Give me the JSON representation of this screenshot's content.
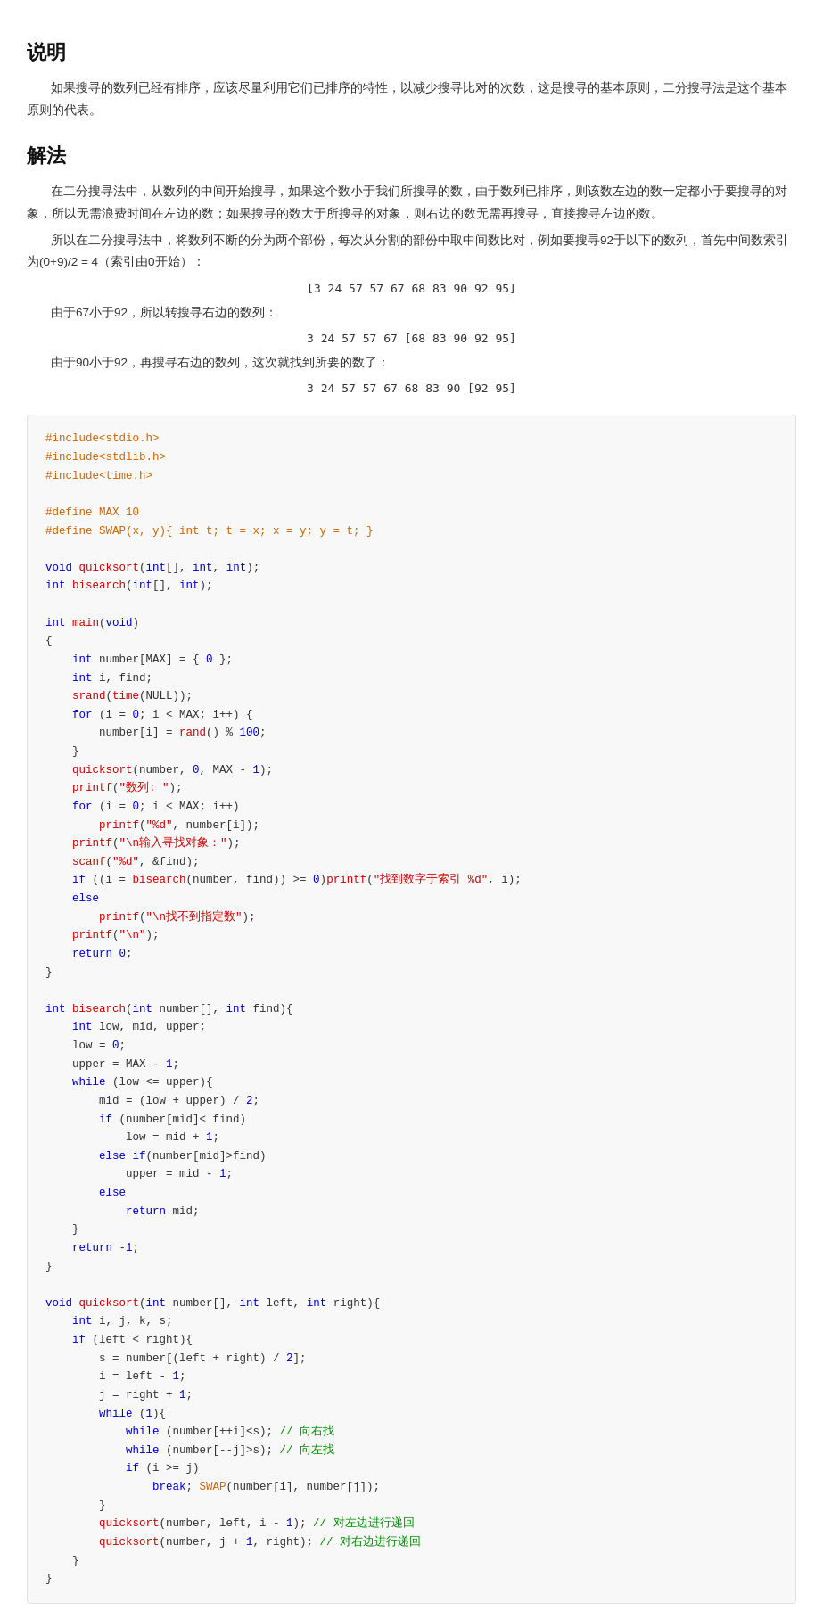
{
  "section1": {
    "title": "说明",
    "paragraphs": [
      "如果搜寻的数列已经有排序，应该尽量利用它们已排序的特性，以减少搜寻比对的次数，这是搜寻的基本原则，二分搜寻法是这个基本原则的代表。"
    ]
  },
  "section2": {
    "title": "解法",
    "paragraphs": [
      "在二分搜寻法中，从数列的中间开始搜寻，如果这个数小于我们所搜寻的数，由于数列已排序，则该数左边的数一定都小于要搜寻的对象，所以无需浪费时间在左边的数；如果搜寻的数大于所搜寻的对象，则右边的数无需再搜寻，直接搜寻左边的数。",
      "所以在二分搜寻法中，将数列不断的分为两个部份，每次从分割的部份中取中间数比对，例如要搜寻92于以下的数列，首先中间数索引为(0+9)/2 = 4（索引由0开始）："
    ],
    "array1_label": "[3  24  57  57  67  68  83  90  92  95]",
    "note1": "由于67小于92，所以转搜寻右边的数列：",
    "array2_label": "3  24  57  57  67  [68  83  90  92  95]",
    "note2": "由于90小于92，再搜寻右边的数列，这次就找到所要的数了：",
    "array3_label": "3  24  57  57  67  68  83  90  [92  95]"
  },
  "code": {
    "content": "code block"
  }
}
